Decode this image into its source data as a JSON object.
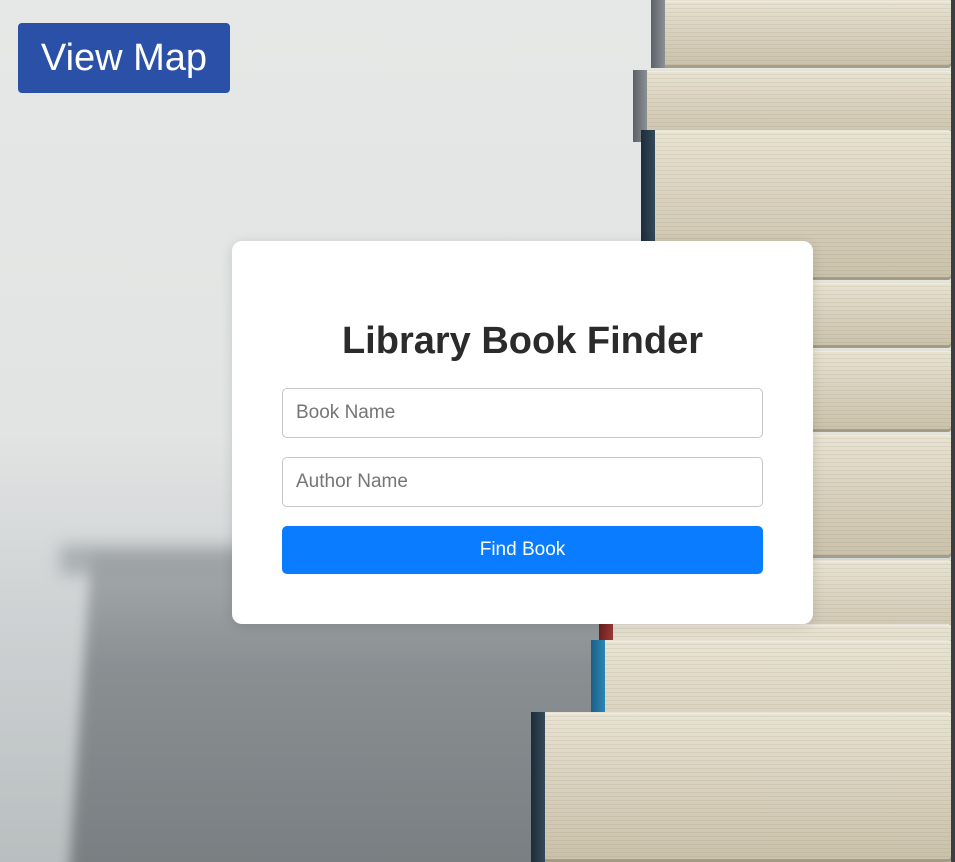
{
  "header": {
    "map_button_label": "View Map"
  },
  "finder": {
    "title": "Library Book Finder",
    "book_field": {
      "placeholder": "Book Name",
      "value": ""
    },
    "author_field": {
      "placeholder": "Author Name",
      "value": ""
    },
    "submit_label": "Find Book"
  },
  "colors": {
    "map_button": "#2a50a8",
    "submit_button": "#0a7cff",
    "card_background": "#ffffff",
    "title_text": "#2b2b2b"
  },
  "background": {
    "image": "stack-of-books-photo"
  }
}
